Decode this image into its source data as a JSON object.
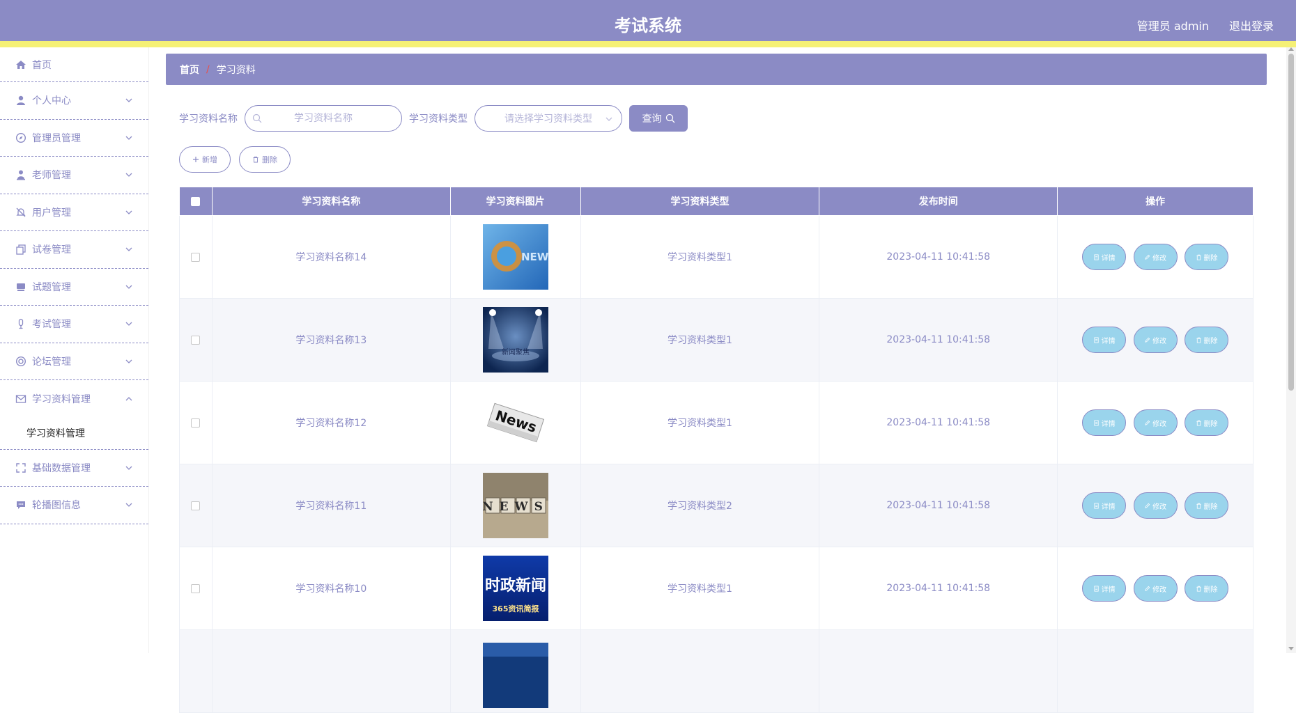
{
  "header": {
    "title": "考试系统",
    "user": "管理员 admin",
    "logout": "退出登录"
  },
  "sidebar": {
    "items": [
      {
        "label": "首页",
        "icon": "home-icon"
      },
      {
        "label": "个人中心",
        "icon": "user-icon"
      },
      {
        "label": "管理员管理",
        "icon": "compass-icon"
      },
      {
        "label": "老师管理",
        "icon": "teacher-icon"
      },
      {
        "label": "用户管理",
        "icon": "bell-off-icon"
      },
      {
        "label": "试卷管理",
        "icon": "copy-icon"
      },
      {
        "label": "试题管理",
        "icon": "stand-icon"
      },
      {
        "label": "考试管理",
        "icon": "mic-icon"
      },
      {
        "label": "论坛管理",
        "icon": "lifebuoy-icon"
      },
      {
        "label": "学习资料管理",
        "icon": "message-icon"
      },
      {
        "label": "基础数据管理",
        "icon": "fullscreen-icon"
      },
      {
        "label": "轮播图信息",
        "icon": "chat-icon"
      }
    ],
    "submenu_label": "学习资料管理"
  },
  "breadcrumb": {
    "home": "首页",
    "separator": "/",
    "current": "学习资料"
  },
  "search": {
    "name_label": "学习资料名称",
    "name_placeholder": "学习资料名称",
    "type_label": "学习资料类型",
    "type_placeholder": "请选择学习资料类型",
    "query_button": "查询"
  },
  "actions": {
    "add": "新增",
    "delete": "删除"
  },
  "table": {
    "columns": [
      "学习资料名称",
      "学习资料图片",
      "学习资料类型",
      "发布时间",
      "操作"
    ],
    "rows": [
      {
        "name": "学习资料名称14",
        "type": "学习资料类型1",
        "time": "2023-04-11 10:41:58",
        "image": "news-globe"
      },
      {
        "name": "学习资料名称13",
        "type": "学习资料类型1",
        "time": "2023-04-11 10:41:58",
        "image": "news-stage"
      },
      {
        "name": "学习资料名称12",
        "type": "学习资料类型1",
        "time": "2023-04-11 10:41:58",
        "image": "news-paper"
      },
      {
        "name": "学习资料名称11",
        "type": "学习资料类型2",
        "time": "2023-04-11 10:41:58",
        "image": "news-blocks"
      },
      {
        "name": "学习资料名称10",
        "type": "学习资料类型1",
        "time": "2023-04-11 10:41:58",
        "image": "news-politics"
      }
    ],
    "row_buttons": {
      "detail": "详情",
      "edit": "修改",
      "delete": "删除"
    },
    "thumb_text": {
      "news_globe": "NEWS",
      "news_stage": "新闻聚焦",
      "news_paper": "News",
      "news_blocks": "NEWS",
      "news_politics_1": "时政新闻",
      "news_politics_2": "365资讯简报"
    }
  },
  "colors": {
    "primary": "#8b8bc5",
    "accent_bar": "#f5f075",
    "op_button": "#9ad4ec"
  }
}
